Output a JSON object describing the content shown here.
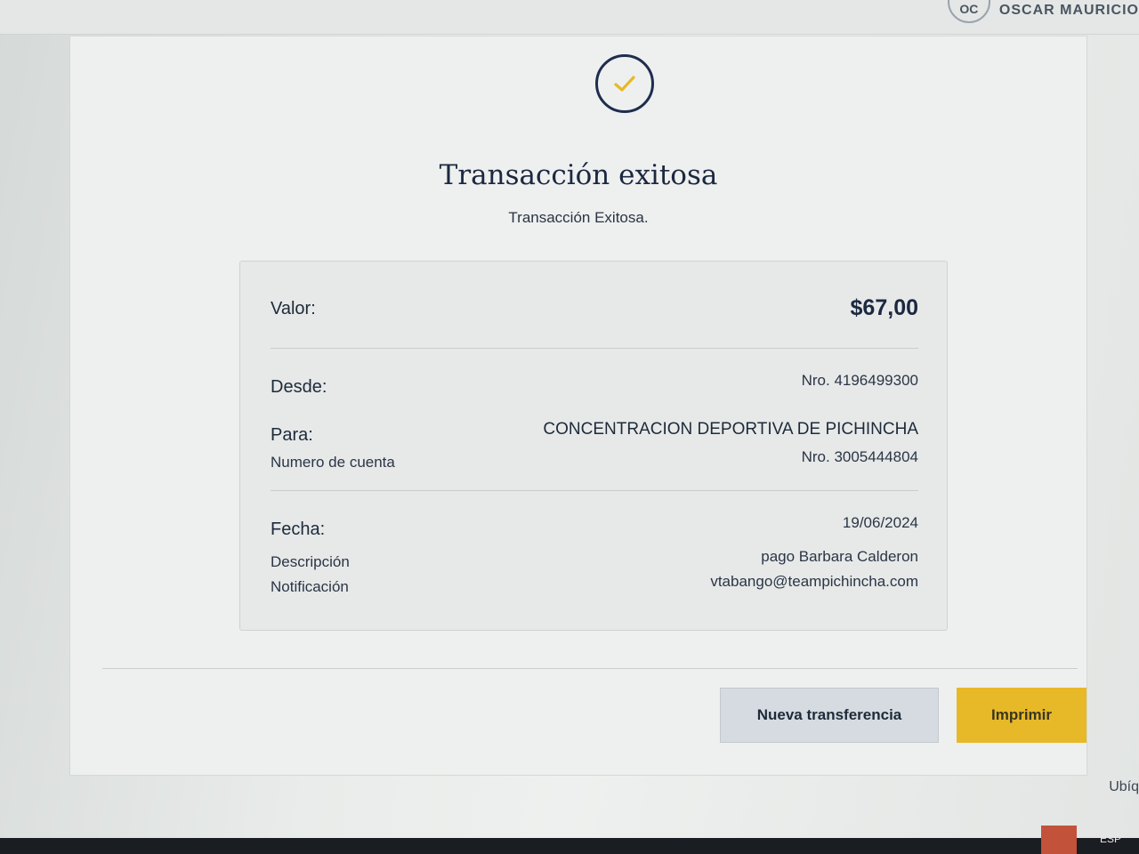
{
  "header": {
    "user_initials": "OC",
    "user_name": "OSCAR MAURICIO"
  },
  "status": {
    "title": "Transacción exitosa",
    "subtitle": "Transacción Exitosa.",
    "icon": "check-icon",
    "icon_color": "#e7b928",
    "ring_color": "#1e2d4f"
  },
  "details": {
    "valor_label": "Valor:",
    "valor_value": "$67,00",
    "desde_label": "Desde:",
    "desde_value": "Nro. 4196499300",
    "para_label": "Para:",
    "para_value": "CONCENTRACION DEPORTIVA DE PICHINCHA",
    "cuenta_label": "Numero de cuenta",
    "cuenta_value": "Nro. 3005444804",
    "fecha_label": "Fecha:",
    "fecha_value": "19/06/2024",
    "descripcion_label": "Descripción",
    "descripcion_value": "pago Barbara Calderon",
    "notificacion_label": "Notificación",
    "notificacion_value": "vtabango@teampichincha.com"
  },
  "actions": {
    "new_transfer_label": "Nueva transferencia",
    "print_label": "Imprimir",
    "print_color": "#e7b928"
  },
  "misc": {
    "side_text": "Ubíq",
    "lang": "ESP"
  }
}
